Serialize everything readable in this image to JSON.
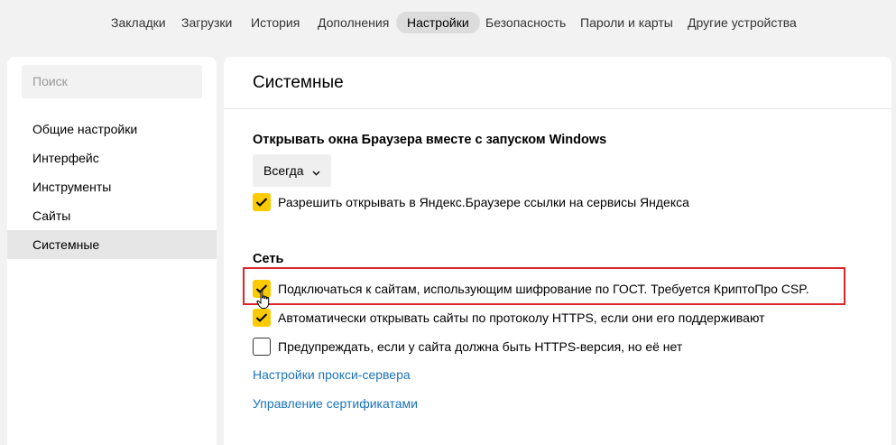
{
  "topnav": {
    "tabs": [
      {
        "label": "Закладки"
      },
      {
        "label": "Загрузки"
      },
      {
        "label": "История"
      },
      {
        "label": "Дополнения"
      },
      {
        "label": "Настройки",
        "active": true
      },
      {
        "label": "Безопасность"
      },
      {
        "label": "Пароли и карты"
      },
      {
        "label": "Другие устройства"
      }
    ]
  },
  "sidebar": {
    "search_placeholder": "Поиск",
    "items": [
      {
        "label": "Общие настройки"
      },
      {
        "label": "Интерфейс"
      },
      {
        "label": "Инструменты"
      },
      {
        "label": "Сайты"
      },
      {
        "label": "Системные",
        "active": true
      }
    ]
  },
  "main": {
    "title": "Системные",
    "startup": {
      "heading": "Открывать окна Браузера вместе с запуском Windows",
      "dropdown_value": "Всегда",
      "allow_links_label": "Разрешить открывать в Яндекс.Браузере ссылки на сервисы Яндекса",
      "allow_links_checked": true
    },
    "network": {
      "heading": "Сеть",
      "options": [
        {
          "label": "Подключаться к сайтам, использующим шифрование по ГОСТ. Требуется КриптоПро CSP.",
          "checked": true
        },
        {
          "label": "Автоматически открывать сайты по протоколу HTTPS, если они его поддерживают",
          "checked": true
        },
        {
          "label": "Предупреждать, если у сайта должна быть HTTPS-версия, но её нет",
          "checked": false
        }
      ],
      "proxy_link": "Настройки прокси-сервера",
      "certs_link": "Управление сертификатами"
    }
  },
  "colors": {
    "accent_checkbox": "#fcca00",
    "link": "#1a73ba",
    "highlight_border": "#d9252b"
  },
  "icons": {
    "checkmark": "checkmark-icon",
    "chevron": "chevron-down-icon",
    "cursor": "hand-pointer-cursor-icon"
  }
}
